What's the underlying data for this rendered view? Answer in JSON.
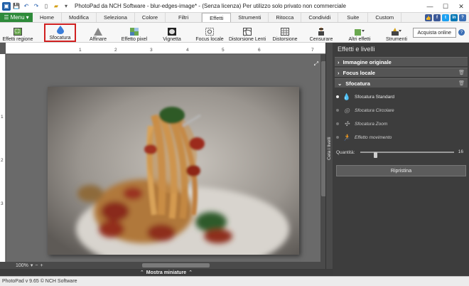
{
  "window": {
    "title": "PhotoPad da NCH Software - blur-edges-image* - (Senza licenza) Per utilizzo solo privato non commerciale",
    "minimize": "—",
    "maximize": "☐",
    "close": "✕"
  },
  "menubar": {
    "menu_label": "Menu",
    "tabs": [
      "Home",
      "Modifica",
      "Seleziona",
      "Colore",
      "Filtri",
      "Effetti",
      "Strumenti",
      "Ritocca",
      "Condividi",
      "Suite",
      "Custom"
    ],
    "active_tab": "Effetti"
  },
  "toolbar": {
    "effetti_regione": "Effetti regione",
    "sfocatura": "Sfocatura",
    "affinare": "Affinare",
    "effetto_pixel": "Effetto pixel",
    "vignetta": "Vignetta",
    "focus_locale": "Focus locale",
    "distorsione_lenti": "Distorsione Lenti",
    "distorsione": "Distorsione",
    "censurare": "Censurare",
    "altri_effetti": "Altri effetti",
    "strumenti": "Strumenti",
    "acquista": "Acquista online",
    "help": "?"
  },
  "ruler": {
    "h_ticks": [
      "1",
      "2",
      "3",
      "4",
      "5",
      "6",
      "7"
    ],
    "v_ticks": [
      "1",
      "2",
      "3"
    ]
  },
  "canvas": {
    "zoom": "100%"
  },
  "strip": {
    "label": "Mostra miniature"
  },
  "side_tab": {
    "label": "Cela i livelli"
  },
  "panel": {
    "title": "Effetti e livelli",
    "sections": {
      "original": "Immagine originale",
      "focus": "Focus locale",
      "blur": "Sfocatura"
    },
    "options": [
      {
        "label": "Sfocatura Standard",
        "icon": "drop-icon",
        "selected": true
      },
      {
        "label": "Sfocatura Circolare",
        "icon": "circular-icon",
        "selected": false
      },
      {
        "label": "Sfocatura Zoom",
        "icon": "zoom-burst-icon",
        "selected": false
      },
      {
        "label": "Effetto movimento",
        "icon": "motion-icon",
        "selected": false
      }
    ],
    "quantity_label": "Quantità:",
    "quantity_value": "16",
    "quantity_fraction": 0.16,
    "reset": "Ripristina"
  },
  "status": {
    "text": "PhotoPad v 9.65 © NCH Software"
  },
  "colors": {
    "accent_green": "#2e8b3a",
    "highlight_red": "#d02020",
    "panel_bg": "#3d3d3d"
  }
}
